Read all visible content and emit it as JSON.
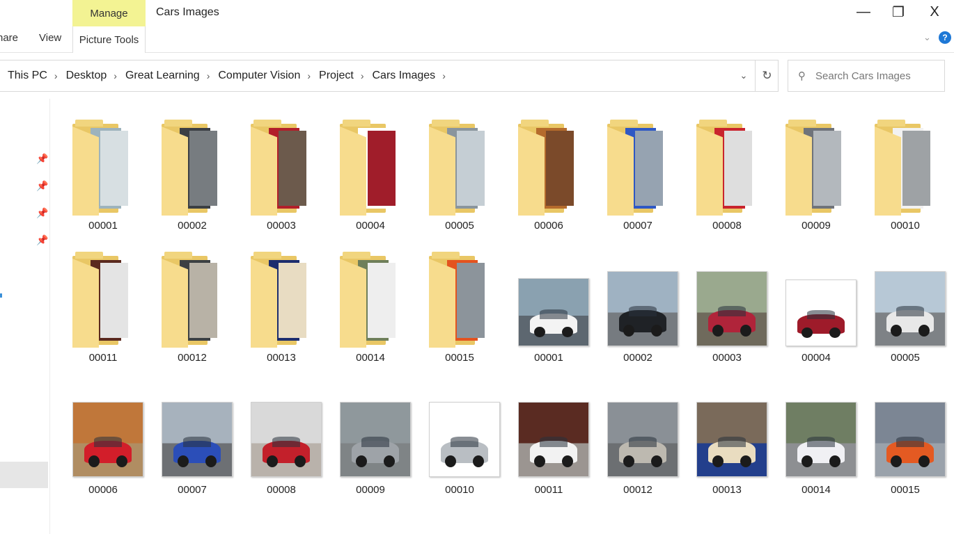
{
  "window": {
    "title": "Cars Images",
    "manage_tab": "Manage",
    "tabs": {
      "share": "hare",
      "view": "View",
      "picture_tools": "Picture Tools"
    },
    "controls": {
      "minimize": "—",
      "maximize": "❐",
      "close": "X"
    }
  },
  "address": {
    "crumbs": [
      "This PC",
      "Desktop",
      "Great Learning",
      "Computer Vision",
      "Project",
      "Cars Images"
    ],
    "separator": "›"
  },
  "search": {
    "placeholder": "Search Cars Images"
  },
  "icons": {
    "pin": "pin-icon",
    "search": "search-icon",
    "refresh": "refresh-icon",
    "dropdown": "chevron-down-icon",
    "help": "help-icon"
  },
  "accent": {
    "manage_tab": "#f3f393",
    "folder": "#f7dc8d",
    "help": "#1e78d6"
  },
  "folders": [
    {
      "name": "00001",
      "colors": [
        "#9db3bd",
        "#d7dfe2"
      ]
    },
    {
      "name": "00002",
      "colors": [
        "#3b3f44",
        "#777c80"
      ]
    },
    {
      "name": "00003",
      "colors": [
        "#b21f2a",
        "#6c5a4c"
      ]
    },
    {
      "name": "00004",
      "colors": [
        "#ffffff",
        "#a01d2a"
      ]
    },
    {
      "name": "00005",
      "colors": [
        "#8a959d",
        "#c5ced4"
      ]
    },
    {
      "name": "00006",
      "colors": [
        "#b56b2c",
        "#7b4a2a"
      ]
    },
    {
      "name": "00007",
      "colors": [
        "#2f58c4",
        "#96a3b1"
      ]
    },
    {
      "name": "00008",
      "colors": [
        "#c9242d",
        "#dedede"
      ]
    },
    {
      "name": "00009",
      "colors": [
        "#6f737a",
        "#b3b8bd"
      ]
    },
    {
      "name": "00010",
      "colors": [
        "#f2f2f2",
        "#9ea2a5"
      ]
    },
    {
      "name": "00011",
      "colors": [
        "#5b2a1f",
        "#e4e4e4"
      ]
    },
    {
      "name": "00012",
      "colors": [
        "#3c4043",
        "#b8b2a6"
      ]
    },
    {
      "name": "00013",
      "colors": [
        "#1c2d6e",
        "#e8dcc2"
      ]
    },
    {
      "name": "00014",
      "colors": [
        "#6f7f5a",
        "#eeeeee"
      ]
    },
    {
      "name": "00015",
      "colors": [
        "#e4531f",
        "#8c949b"
      ]
    }
  ],
  "images": [
    {
      "name": "00001",
      "bg": "#8aa1b0",
      "ground": "#5d6770",
      "car": "#f3f3f3"
    },
    {
      "name": "00002",
      "bg": "#9fb2c2",
      "ground": "#767b80",
      "car": "#1f2226"
    },
    {
      "name": "00003",
      "bg": "#9aa98e",
      "ground": "#6f6a5c",
      "car": "#b0243a"
    },
    {
      "name": "00004",
      "bg": "#ffffff",
      "ground": "#ffffff",
      "car": "#9e1b2a"
    },
    {
      "name": "00005",
      "bg": "#b7c8d6",
      "ground": "#7e8286",
      "car": "#e8e8e8"
    },
    {
      "name": "00006",
      "bg": "#c0773a",
      "ground": "#b08d62",
      "car": "#d21e2a"
    },
    {
      "name": "00007",
      "bg": "#a7b2bd",
      "ground": "#6d7074",
      "car": "#2b4eb8"
    },
    {
      "name": "00008",
      "bg": "#d9d9d9",
      "ground": "#b9b2ab",
      "car": "#c3202b"
    },
    {
      "name": "00009",
      "bg": "#8f989c",
      "ground": "#7f8486",
      "car": "#9ea3a8"
    },
    {
      "name": "00010",
      "bg": "#ffffff",
      "ground": "#ffffff",
      "car": "#b9bec3"
    },
    {
      "name": "00011",
      "bg": "#5a2b22",
      "ground": "#9b9591",
      "car": "#f2f2f2"
    },
    {
      "name": "00012",
      "bg": "#8a9096",
      "ground": "#6c6f72",
      "car": "#bdb9b0"
    },
    {
      "name": "00013",
      "bg": "#7a6a5a",
      "ground": "#233f8c",
      "car": "#e9dcc0"
    },
    {
      "name": "00014",
      "bg": "#6f7e63",
      "ground": "#8d8f92",
      "car": "#f0f0f4"
    },
    {
      "name": "00015",
      "bg": "#7c8694",
      "ground": "#9aa2ab",
      "car": "#e45a22"
    }
  ]
}
